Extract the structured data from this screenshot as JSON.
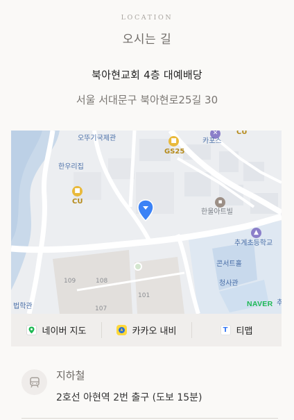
{
  "header": {
    "eyebrow": "LOCATION",
    "title": "오시는 길"
  },
  "venue": {
    "name": "북아현교회 4층 대예배당",
    "address": "서울 서대문구 북아현로25길 30"
  },
  "map": {
    "provider_logo": "NAVER",
    "marker_icon": "location-pin-icon",
    "labels": {
      "otteugi": "오뚜기국제관",
      "hanwoo": "한우리집",
      "cu_left": "CU",
      "gs25": "GS25",
      "kapos": "카포스",
      "cu_top": "CU",
      "hanul": "한울아트빌",
      "chugye": "추계초등학교",
      "concert_hall": "콘서트홀",
      "cheongsa": "청사관",
      "bldg_109": "109",
      "bldg_108": "108",
      "bldg_101": "101",
      "bldg_107": "107",
      "law_hall": "법학관",
      "law_extra": "추"
    },
    "colors": {
      "water": "#c7d8ea",
      "road": "#ffffff",
      "block": "#e6e8ec",
      "campus": "#dfe9f3",
      "marker": "#3b82f6"
    }
  },
  "navigation": [
    {
      "label": "네이버 지도",
      "icon": "naver-map-icon"
    },
    {
      "label": "카카오 내비",
      "icon": "kakao-navi-icon"
    },
    {
      "label": "티맵",
      "icon": "tmap-icon"
    }
  ],
  "transit": {
    "icon": "subway-icon",
    "heading": "지하철",
    "detail": "2호선 아현역 2번 출구 (도보 15분)"
  }
}
